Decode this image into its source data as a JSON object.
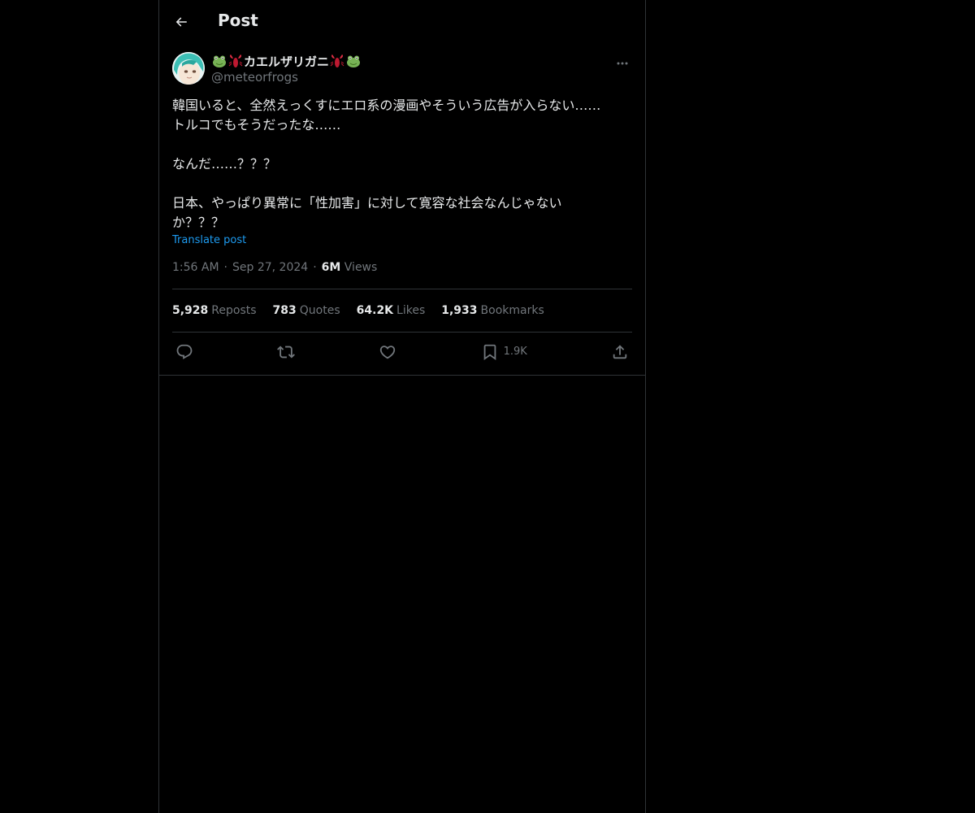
{
  "header": {
    "title": "Post"
  },
  "author": {
    "display_name": "カエルザリガニ",
    "handle": "@meteorfrogs"
  },
  "post": {
    "lines": [
      "韓国いると、全然えっくすにエロ系の漫画やそういう広告が入らない……",
      "トルコでもそうだったな……",
      "",
      "なんだ……？？？",
      "",
      "日本、やっぱり異常に「性加害」に対して寛容な社会なんじゃない",
      "か？？？"
    ],
    "translate_label": "Translate post",
    "time": "1:56 AM",
    "date": "Sep 27, 2024",
    "views_count": "6M",
    "views_label": "Views"
  },
  "stats": {
    "reposts_count": "5,928",
    "reposts_label": "Reposts",
    "quotes_count": "783",
    "quotes_label": "Quotes",
    "likes_count": "64.2K",
    "likes_label": "Likes",
    "bookmarks_count": "1,933",
    "bookmarks_label": "Bookmarks"
  },
  "actions": {
    "reply_icon": "reply-icon",
    "repost_icon": "repost-icon",
    "like_icon": "heart-icon",
    "bookmark_icon": "bookmark-icon",
    "bookmark_count": "1.9K",
    "share_icon": "share-icon"
  },
  "colors": {
    "background": "#000000",
    "text": "#e7e9ea",
    "secondary": "#71767b",
    "link": "#1d9bf0",
    "border": "#2f3336"
  }
}
